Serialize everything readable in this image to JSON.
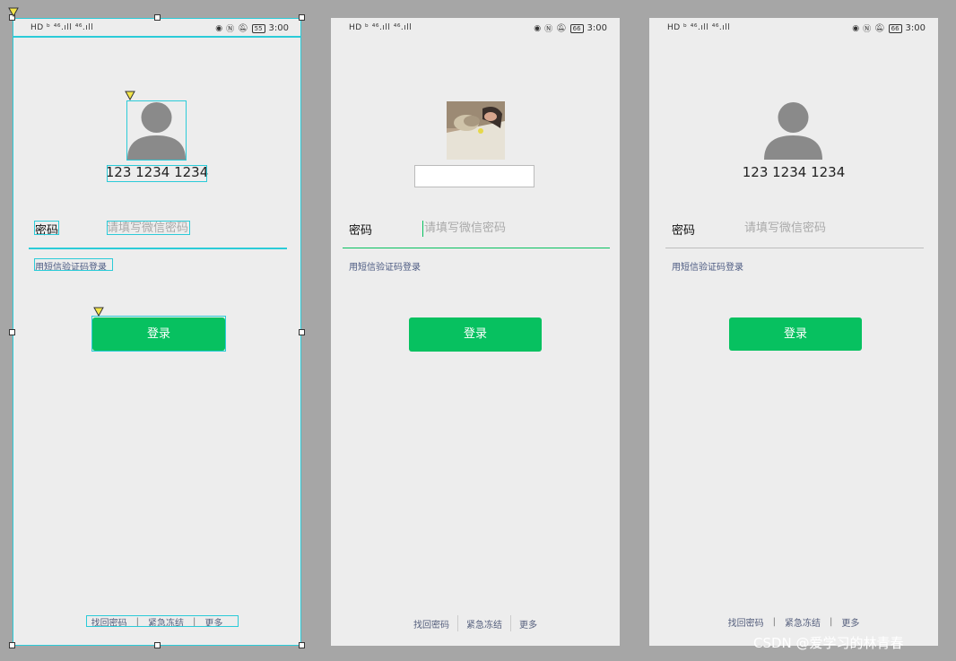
{
  "status_bar": {
    "left": "HD ᵇ ⁴⁶.ıll ⁴⁶.ıll",
    "icons": [
      "eye-icon",
      "nfc-icon",
      "bell-off-icon"
    ],
    "battery_phone1": "55",
    "battery_phone2": "66",
    "battery_phone3": "66",
    "time": "3:00"
  },
  "phone_number": "123 1234 1234",
  "password": {
    "label": "密码",
    "placeholder": "请填写微信密码"
  },
  "sms_login_link": "用短信验证码登录",
  "login_button": "登录",
  "footer": {
    "find_password": "找回密码",
    "separator": "|",
    "emergency_freeze": "紧急冻结",
    "more": "更多"
  },
  "watermark": "CSDN @爱学习的林青春",
  "colors": {
    "accent": "#07c160",
    "selection": "#2bcbd8",
    "link": "#4c5a82",
    "background": "#ededed",
    "canvas": "#a6a6a6"
  }
}
